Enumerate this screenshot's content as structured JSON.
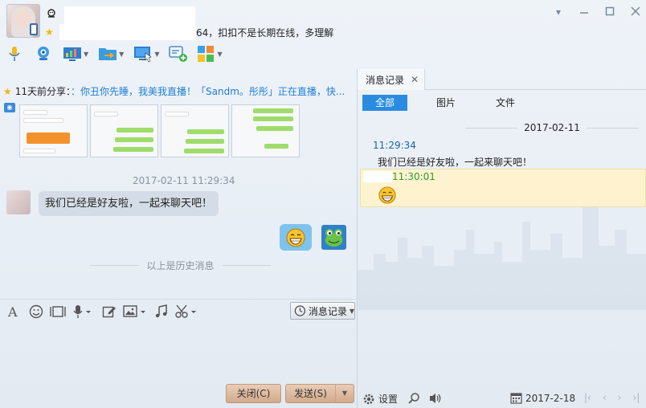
{
  "header": {
    "signature_suffix": "64，扣扣不是长期在线，多理解",
    "status_icon": "shield-qq-icon",
    "star_icon": "star-icon"
  },
  "window_controls": [
    "chevron-down-icon",
    "minimize-icon",
    "maximize-icon",
    "close-icon"
  ],
  "toolbar": [
    "microphone-icon",
    "video-camera-icon",
    "screen-share-icon",
    "file-transfer-icon",
    "remote-desktop-icon",
    "add-chat-icon",
    "apps-grid-icon"
  ],
  "share": {
    "prefix": "11天前分享：",
    "text": "：你丑你先睡，我美我直播！「Sandm。彤彤」正在直播，快..."
  },
  "chat": {
    "timestamp": "2017-02-11 11:29:34",
    "message": "我们已经是好友啦，一起来聊天吧！",
    "history_label": "以上是历史消息"
  },
  "input_toolbar": {
    "icons": [
      "font-icon",
      "emoji-icon",
      "gif-icon",
      "voice-icon",
      "edit-icon",
      "image-icon",
      "music-icon",
      "screenshot-icon"
    ],
    "msg_record_label": "消息记录"
  },
  "buttons": {
    "close": "关闭(C)",
    "send": "发送(S)"
  },
  "right_panel": {
    "tab_label": "消息记录",
    "filters": [
      "全部",
      "图片",
      "文件"
    ],
    "date": "2017-02-11",
    "entry1_time": "11:29:34",
    "entry1_text": "我们已经是好友啦，一起来聊天吧！",
    "entry2_time": "11:30:01",
    "bottom": {
      "settings": "设置",
      "date": "2017-2-18"
    }
  },
  "colors": {
    "accent": "#2a8ce0",
    "link": "#1f7ed6",
    "highlight": "#fff3cf",
    "button": "#d3a98a"
  }
}
